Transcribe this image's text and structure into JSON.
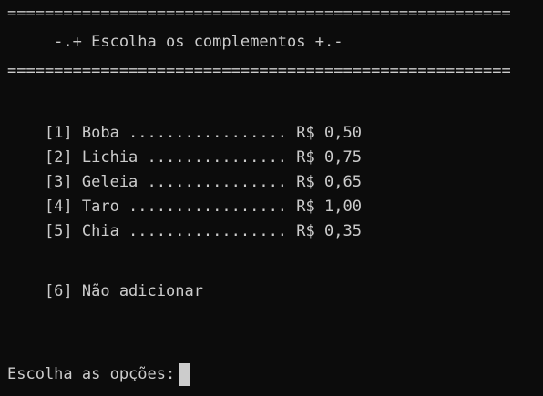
{
  "header": {
    "top_rule": "======================================================",
    "title": "     -.+ Escolha os complementos +.-",
    "bottom_rule": "======================================================"
  },
  "menu": {
    "items": [
      {
        "text": "    [1] Boba ................. R$ 0,50"
      },
      {
        "text": "    [2] Lichia ............... R$ 0,75"
      },
      {
        "text": "    [3] Geleia ............... R$ 0,65"
      },
      {
        "text": "    [4] Taro ................. R$ 1,00"
      },
      {
        "text": "    [5] Chia ................. R$ 0,35"
      }
    ],
    "skip_option": "    [6] Não adicionar"
  },
  "prompt": {
    "label": "Escolha as opções:"
  },
  "colors": {
    "background": "#0c0c0c",
    "foreground": "#cccccc"
  }
}
